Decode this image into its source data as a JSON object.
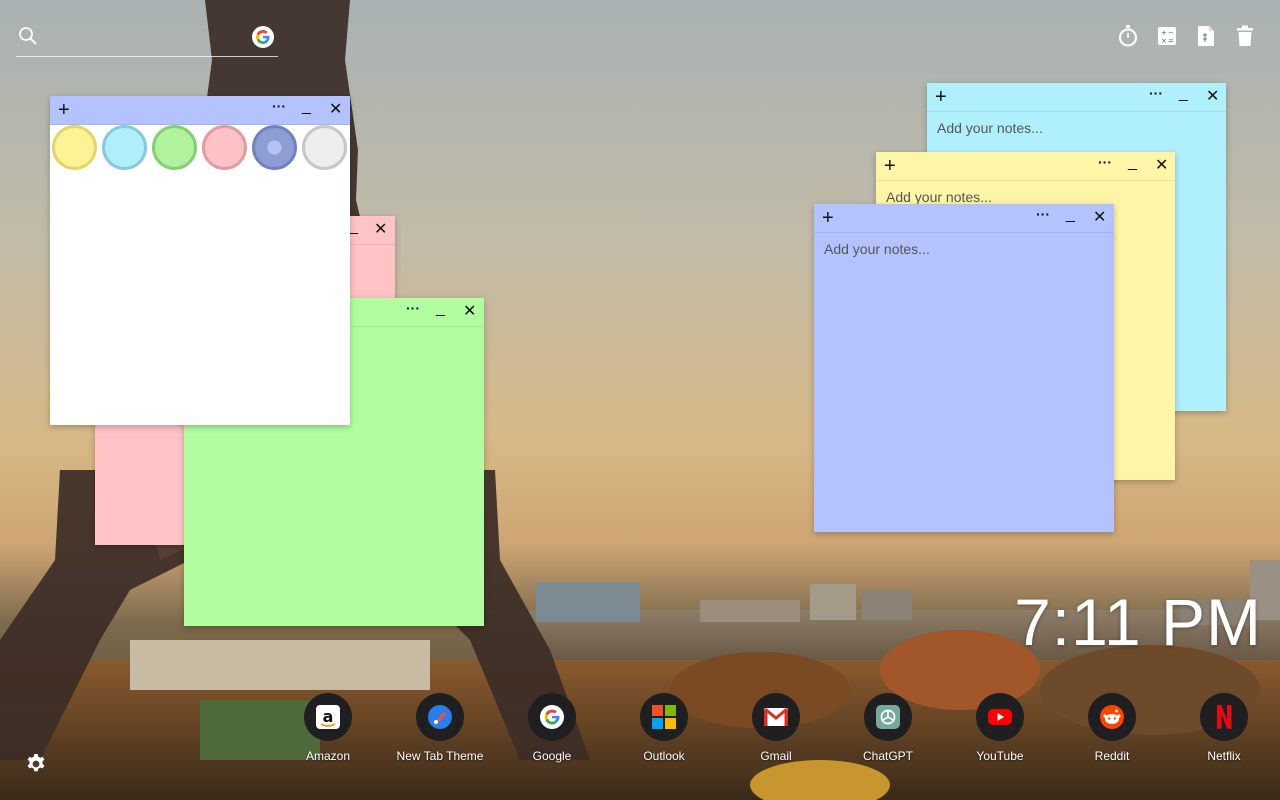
{
  "search": {
    "placeholder": "",
    "value": ""
  },
  "toolbar": {
    "icons": [
      "stopwatch-icon",
      "calculator-icon",
      "document-icon",
      "trash-icon"
    ]
  },
  "notes": {
    "plus_label": "+",
    "more_label": "···",
    "minimize_label": "_",
    "close_label": "✕",
    "placeholder": "Add your notes...",
    "colors": {
      "white": "#ffffff",
      "pink": "#ffc3c6",
      "green": "#b2fd9f",
      "cyan": "#b0f0fd",
      "yellow": "#fef6a7",
      "periwinkle": "#b4c3fe"
    },
    "palette": [
      {
        "name": "yellow",
        "fill": "#fdf396",
        "ring": "#e0d66a"
      },
      {
        "name": "cyan",
        "fill": "#b0eef9",
        "ring": "#86c9d8"
      },
      {
        "name": "green",
        "fill": "#b1f29f",
        "ring": "#83cf72"
      },
      {
        "name": "pink",
        "fill": "#fdc2c5",
        "ring": "#e09ca1"
      },
      {
        "name": "periwinkle",
        "fill": "#8e9ed4",
        "ring": "#7282bd"
      },
      {
        "name": "gray",
        "fill": "#eeeeee",
        "ring": "#c7c7c7"
      }
    ]
  },
  "clock": {
    "time": "7:11 PM"
  },
  "shortcuts": [
    {
      "label": "Amazon",
      "icon": "amazon-icon"
    },
    {
      "label": "New Tab Theme",
      "icon": "new-tab-theme-icon"
    },
    {
      "label": "Google",
      "icon": "google-icon"
    },
    {
      "label": "Outlook",
      "icon": "outlook-icon"
    },
    {
      "label": "Gmail",
      "icon": "gmail-icon"
    },
    {
      "label": "ChatGPT",
      "icon": "chatgpt-icon"
    },
    {
      "label": "YouTube",
      "icon": "youtube-icon"
    },
    {
      "label": "Reddit",
      "icon": "reddit-icon"
    },
    {
      "label": "Netflix",
      "icon": "netflix-icon"
    }
  ]
}
